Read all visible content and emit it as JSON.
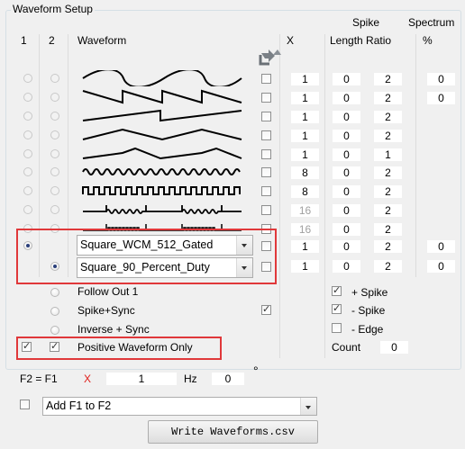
{
  "title": "Waveform Setup",
  "headers": {
    "col1": "1",
    "col2": "2",
    "waveform": "Waveform",
    "x": "X",
    "spike_top": "Spike",
    "spike_bottom": "Length Ratio",
    "spectrum_top": "Spectrum",
    "spectrum_bottom": "%"
  },
  "rows": [
    {
      "wave": "sine-icon",
      "x": "1",
      "length": "0",
      "ratio": "2",
      "spectrum": "0",
      "x_dim": false
    },
    {
      "wave": "sawtooth-down-icon",
      "x": "1",
      "length": "0",
      "ratio": "2",
      "spectrum": "0",
      "x_dim": false
    },
    {
      "wave": "sawtooth-up-icon",
      "x": "1",
      "length": "0",
      "ratio": "2",
      "spectrum": "",
      "x_dim": false
    },
    {
      "wave": "triangle-icon",
      "x": "1",
      "length": "0",
      "ratio": "2",
      "spectrum": "",
      "x_dim": false
    },
    {
      "wave": "triangle-peak-icon",
      "x": "1",
      "length": "0",
      "ratio": "1",
      "spectrum": "",
      "x_dim": false
    },
    {
      "wave": "modulated-sine-icon",
      "x": "8",
      "length": "0",
      "ratio": "2",
      "spectrum": "",
      "x_dim": false
    },
    {
      "wave": "modulated-square-icon",
      "x": "8",
      "length": "0",
      "ratio": "2",
      "spectrum": "",
      "x_dim": false
    },
    {
      "wave": "burst-icon",
      "x": "16",
      "length": "0",
      "ratio": "2",
      "spectrum": "",
      "x_dim": true
    },
    {
      "wave": "burst-square-icon",
      "x": "16",
      "length": "0",
      "ratio": "2",
      "spectrum": "",
      "x_dim": true
    }
  ],
  "custom_rows": [
    {
      "combo": "Square_WCM_512_Gated",
      "x": "1",
      "length": "0",
      "ratio": "2",
      "spectrum": "0"
    },
    {
      "combo": "Square_90_Percent_Duty",
      "x": "1",
      "length": "0",
      "ratio": "2",
      "spectrum": "0"
    }
  ],
  "options": {
    "follow_out_1": "Follow Out 1",
    "spike_sync": "Spike+Sync",
    "inverse_sync": "Inverse + Sync",
    "positive_only": "Positive Waveform Only"
  },
  "spike_options": {
    "plus_spike": "+ Spike",
    "minus_spike": "- Spike",
    "minus_edge": "- Edge",
    "count_label": "Count",
    "count_value": "0"
  },
  "f2": {
    "label": "F2 = F1",
    "x_symbol": "X",
    "multiplier": "1",
    "hz": "Hz",
    "phase": "0",
    "degree": "°"
  },
  "add_combo": "Add F1 to F2",
  "write_button": "Write Waveforms.csv",
  "colors": {
    "highlight": "#e0383a",
    "x_symbol": "#e0201c"
  }
}
